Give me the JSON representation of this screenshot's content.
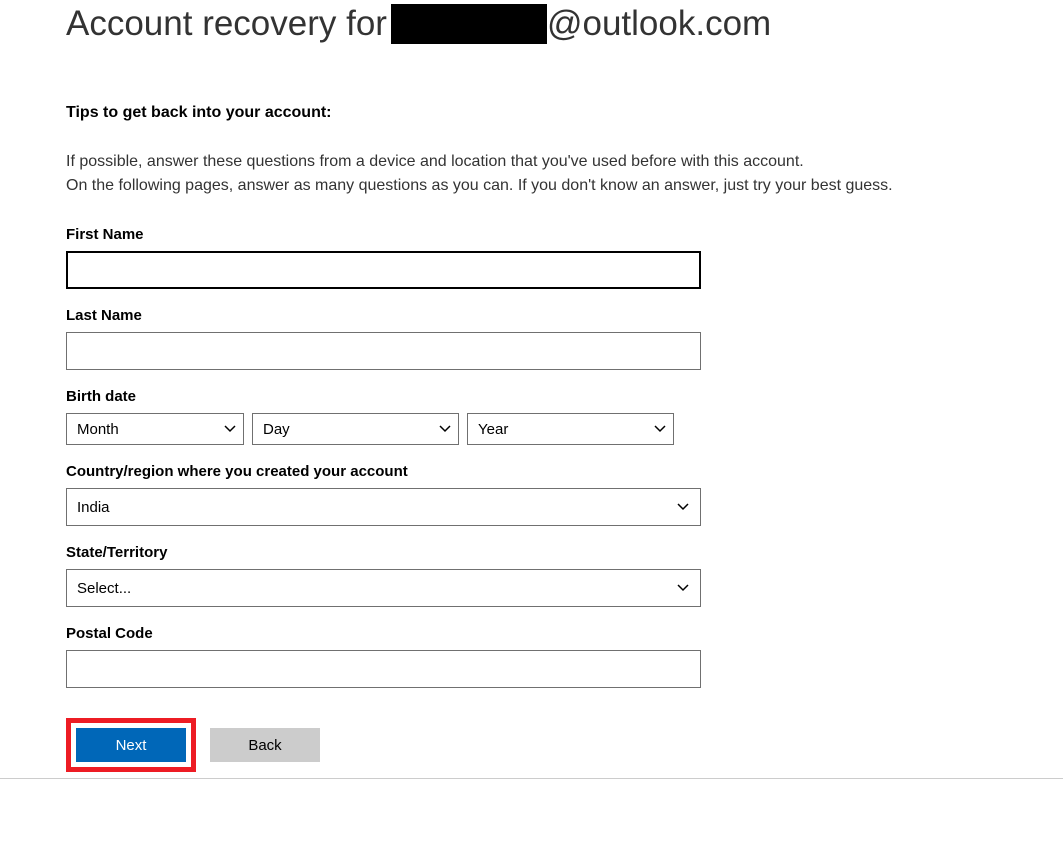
{
  "header": {
    "title_prefix": "Account recovery for ",
    "email_domain": "@outlook.com"
  },
  "tips": {
    "heading": "Tips to get back into your account:",
    "line1": "If possible, answer these questions from a device and location that you've used before with this account.",
    "line2": "On the following pages, answer as many questions as you can. If you don't know an answer, just try your best guess."
  },
  "form": {
    "first_name": {
      "label": "First Name",
      "value": ""
    },
    "last_name": {
      "label": "Last Name",
      "value": ""
    },
    "birth_date": {
      "label": "Birth date",
      "month": "Month",
      "day": "Day",
      "year": "Year"
    },
    "country": {
      "label": "Country/region where you created your account",
      "value": "India"
    },
    "state": {
      "label": "State/Territory",
      "value": "Select..."
    },
    "postal": {
      "label": "Postal Code",
      "value": ""
    }
  },
  "buttons": {
    "next": "Next",
    "back": "Back"
  }
}
